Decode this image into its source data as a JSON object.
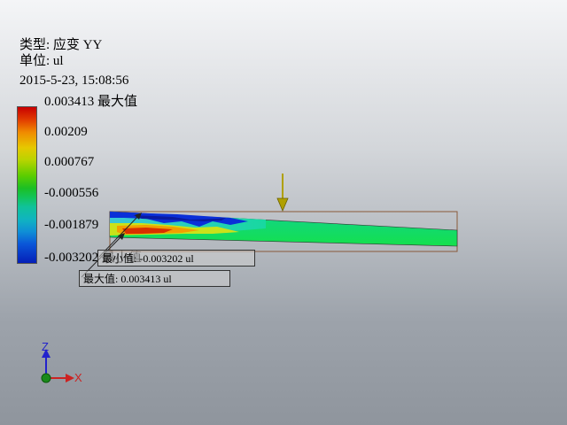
{
  "header": {
    "type_line": "类型: 应变 YY",
    "unit_line": "单位: ul",
    "timestamp": "2015-5-23, 15:08:56"
  },
  "legend": {
    "labels": [
      "0.003413 最大值",
      "0.00209",
      "0.000767",
      "-0.000556",
      "-0.001879",
      "-0.003202 最小值"
    ]
  },
  "callouts": {
    "min": "最小值: -0.003202 ul",
    "max": "最大值: 0.003413 ul"
  },
  "triad": {
    "z_label": "Z",
    "x_label": "X"
  },
  "colors": {
    "max_red": "#c80000",
    "min_blue": "#051fb8",
    "load_arrow": "#b0a000",
    "axis_z": "#2222cc",
    "axis_x": "#cc2222",
    "origin": "#1a8a1a"
  }
}
